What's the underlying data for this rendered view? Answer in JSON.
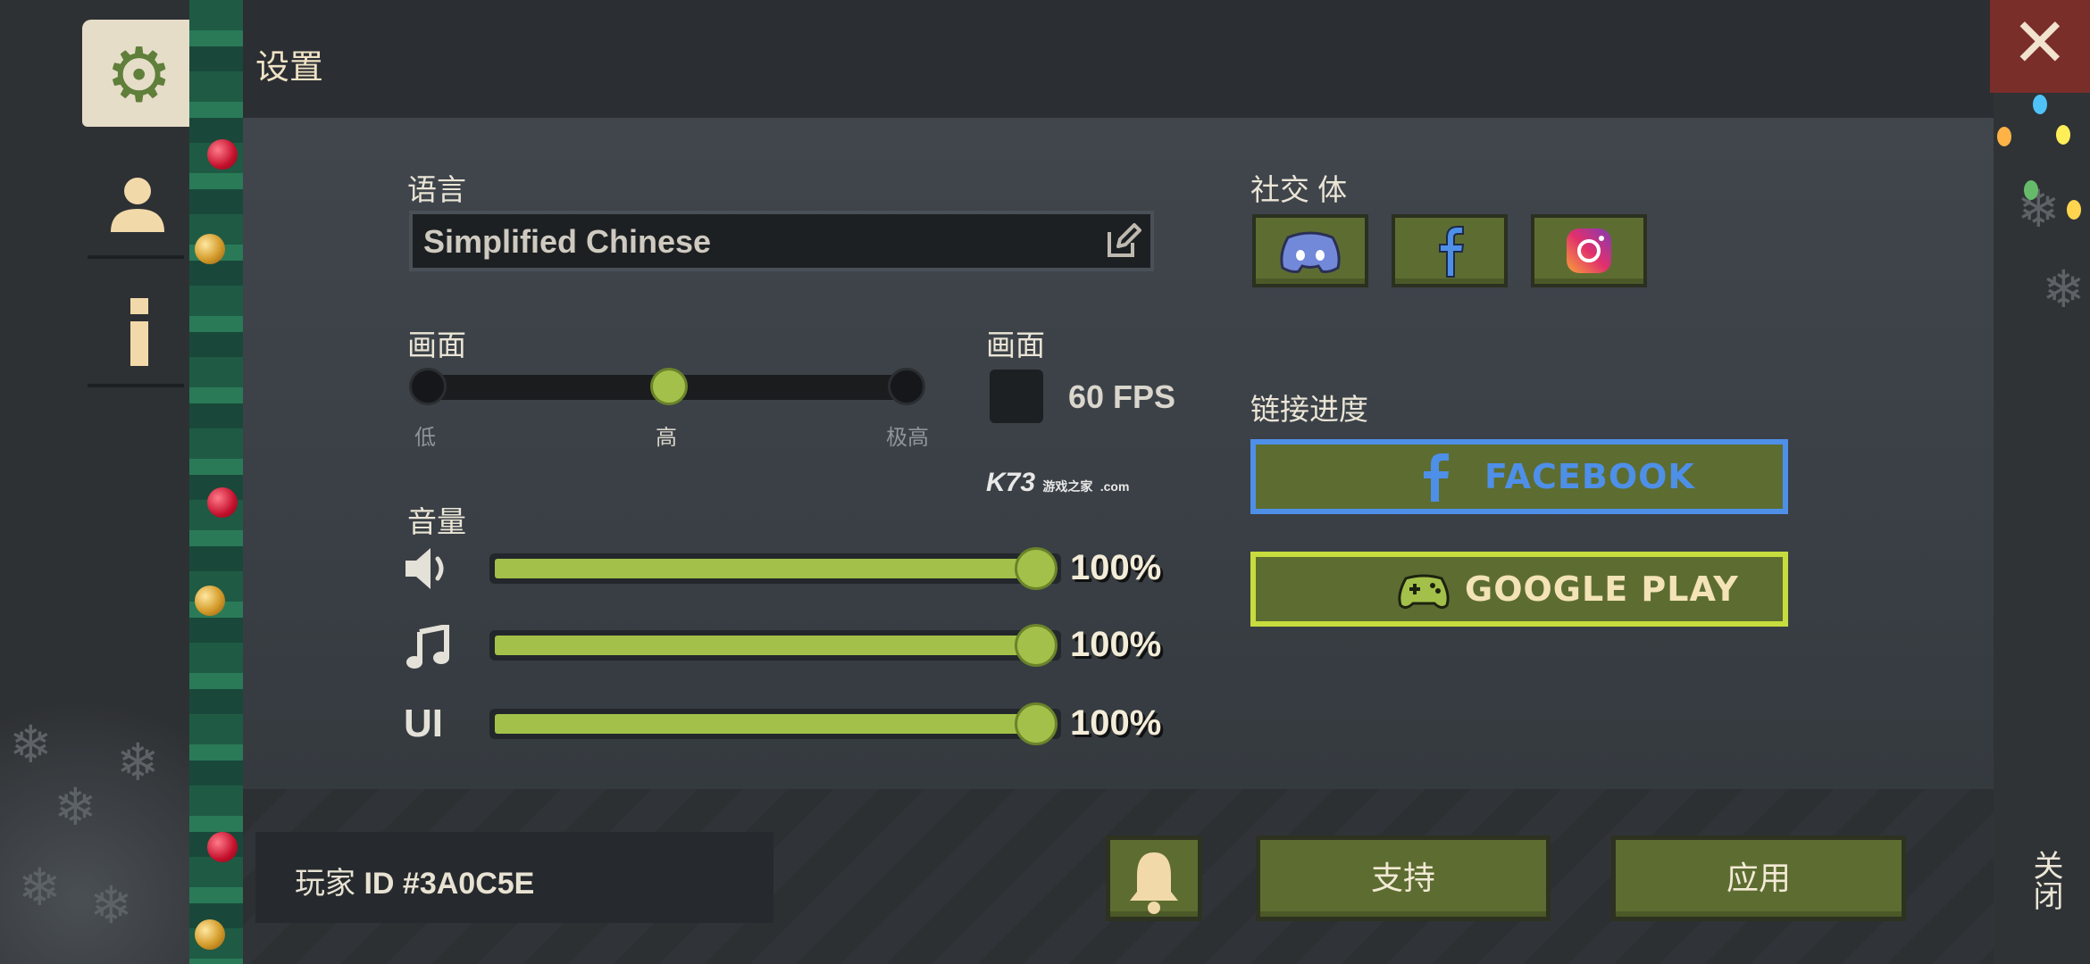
{
  "header": {
    "title": "设置"
  },
  "sidebar": {
    "items": [
      {
        "icon": "gear-icon"
      },
      {
        "icon": "user-icon"
      },
      {
        "icon": "info-icon"
      }
    ]
  },
  "language": {
    "label": "语言",
    "value": "Simplified Chinese"
  },
  "quality": {
    "label": "画面",
    "options": [
      "低",
      "高",
      "极高"
    ],
    "selected": "高"
  },
  "fps": {
    "label": "画面",
    "value": "60 FPS",
    "checked": false
  },
  "volume": {
    "label": "音量",
    "channels": [
      {
        "icon": "speaker-icon",
        "value": "100%",
        "level": 1.0
      },
      {
        "icon": "music-note-icon",
        "value": "100%",
        "level": 1.0
      },
      {
        "icon_text": "UI",
        "value": "100%",
        "level": 1.0
      }
    ]
  },
  "social": {
    "label": "社交 体",
    "links": [
      "discord-icon",
      "facebook-icon",
      "instagram-icon"
    ]
  },
  "link_progress": {
    "label": "链接进度",
    "facebook": "FACEBOOK",
    "google_play": "GOOGLE PLAY"
  },
  "footer": {
    "player_prefix": "玩家 ",
    "player_id_label": "ID",
    "player_id": "#3A0C5E",
    "support": "支持",
    "apply": "应用"
  },
  "close": {
    "label": "关闭"
  },
  "watermark": {
    "text": "K73",
    "sub": "游戏之家",
    "domain": ".com"
  },
  "colors": {
    "accent_green": "#a3c14a",
    "button_green": "#5d6d31",
    "facebook_blue": "#4e8fe8",
    "google_yellow": "#c7dc3e",
    "close_red": "#7a2e2a"
  }
}
